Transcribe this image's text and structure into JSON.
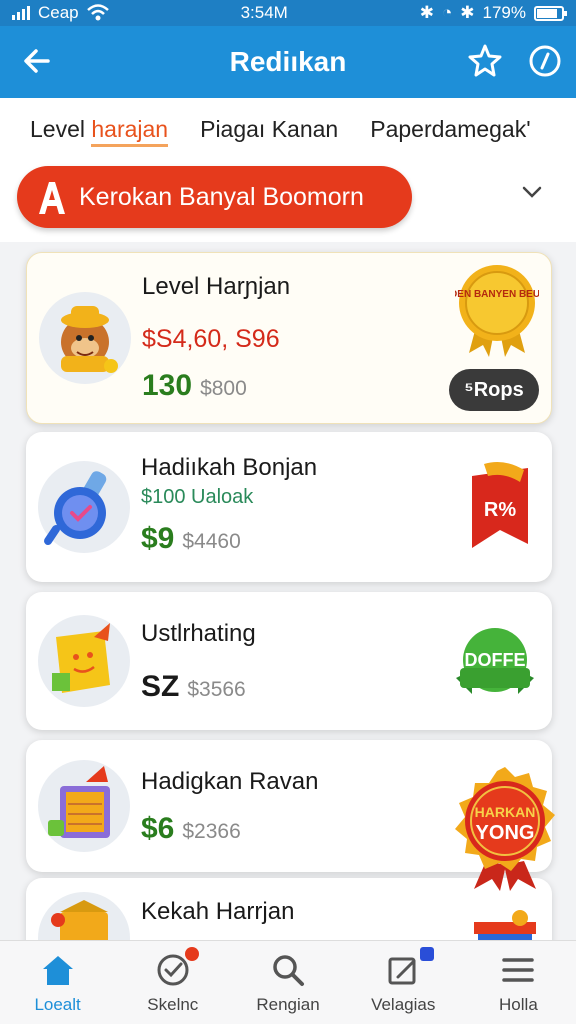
{
  "status": {
    "carrier": "Ceap",
    "time": "3:54M",
    "battery": "179%",
    "battery_level": 0.85
  },
  "appbar": {
    "title": "Rediıkan"
  },
  "tabs": [
    {
      "pre": "Level ",
      "accent": "harajan"
    },
    {
      "label": "Piagaı Kanan"
    },
    {
      "label": "Paperdamegak'"
    }
  ],
  "filter": {
    "label": "Kerokan Banyal Boomorn"
  },
  "cards": [
    {
      "title": "Level Harɲjan",
      "red_price": "$S4,60, S96",
      "price": "130",
      "old_price": "$800",
      "badge_text": "BIDDEN BANYEN BEUNDS",
      "pill": "⁵Rops"
    },
    {
      "title": "Hadiıkah Bonjan",
      "sub": "$100 Ualoak",
      "price": "$9",
      "old_price": "$4460",
      "badge_text": "R%"
    },
    {
      "title": "Ustlrhating",
      "price": "SZ",
      "old_price": "$3566",
      "badge_text": "DOFFE"
    },
    {
      "title": "Hadigkan Ravan",
      "price": "$6",
      "old_price": "$2366"
    },
    {
      "title": "Kekah Harrjan"
    }
  ],
  "float_badge": {
    "line1": "HARKAN",
    "line2": "YONG"
  },
  "nav": [
    {
      "label": "Loealt",
      "icon": "home-icon"
    },
    {
      "label": "Skelnc",
      "icon": "check-circle-icon"
    },
    {
      "label": "Rengian",
      "icon": "search-icon"
    },
    {
      "label": "Velagias",
      "icon": "edit-icon"
    },
    {
      "label": "Holla",
      "icon": "menu-icon"
    }
  ],
  "colors": {
    "primary": "#1e8fd8",
    "accent_red": "#e53a1c",
    "green_price": "#2a7d1e"
  }
}
